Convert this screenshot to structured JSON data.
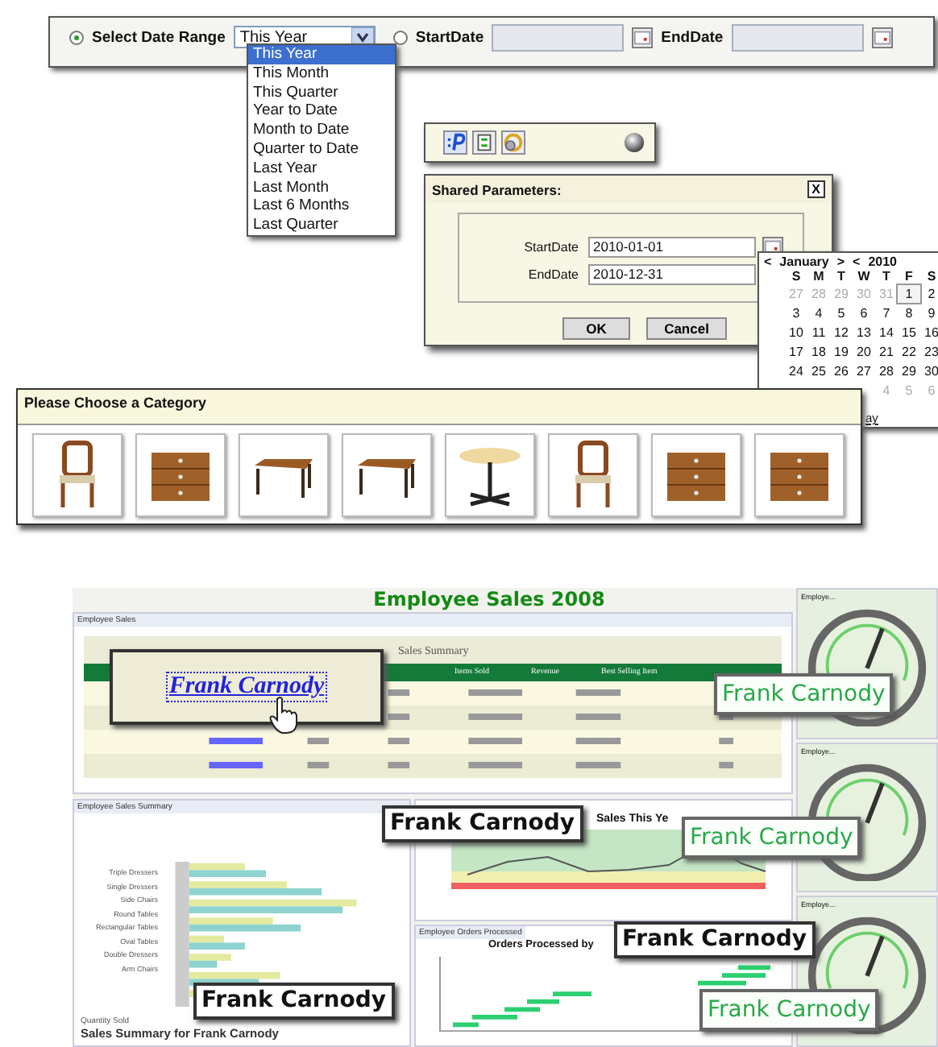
{
  "date_range_bar": {
    "range_option": {
      "label": "Select Date Range",
      "selected": true
    },
    "range_select": {
      "value": "This Year"
    },
    "date_option": {
      "selected": false
    },
    "start_label": "StartDate",
    "end_label": "EndDate"
  },
  "range_dropdown": {
    "items": [
      {
        "label": "This Year",
        "selected": true
      },
      {
        "label": "This Month",
        "selected": false
      },
      {
        "label": "This Quarter",
        "selected": false
      },
      {
        "label": "Year to Date",
        "selected": false
      },
      {
        "label": "Month to Date",
        "selected": false
      },
      {
        "label": "Quarter to Date",
        "selected": false
      },
      {
        "label": "Last Year",
        "selected": false
      },
      {
        "label": "Last Month",
        "selected": false
      },
      {
        "label": "Last 6 Months",
        "selected": false
      },
      {
        "label": "Last Quarter",
        "selected": false
      }
    ]
  },
  "shared_parameters": {
    "title": "Shared Parameters:",
    "close": "X",
    "fields": [
      {
        "label": "StartDate",
        "value": "2010-01-01",
        "calendar": true
      },
      {
        "label": "EndDate",
        "value": "2010-12-31"
      }
    ],
    "buttons": [
      "OK",
      "Cancel"
    ]
  },
  "calendar": {
    "prev_month": "<",
    "month": "January",
    "next_month": ">",
    "prev_year": "<",
    "year": "2010",
    "weekdays": [
      "S",
      "M",
      "T",
      "W",
      "T",
      "F",
      "S"
    ],
    "weeks": [
      [
        {
          "day": "27",
          "other_month": true,
          "selected": false
        },
        {
          "day": "28",
          "other_month": true,
          "selected": false
        },
        {
          "day": "29",
          "other_month": true,
          "selected": false
        },
        {
          "day": "30",
          "other_month": true,
          "selected": false
        },
        {
          "day": "31",
          "other_month": true,
          "selected": false
        },
        {
          "day": "1",
          "other_month": false,
          "selected": true
        },
        {
          "day": "2",
          "other_month": false,
          "selected": false
        }
      ],
      [
        {
          "day": "3",
          "other_month": false,
          "selected": false
        },
        {
          "day": "4",
          "other_month": false,
          "selected": false
        },
        {
          "day": "5",
          "other_month": false,
          "selected": false
        },
        {
          "day": "6",
          "other_month": false,
          "selected": false
        },
        {
          "day": "7",
          "other_month": false,
          "selected": false
        },
        {
          "day": "8",
          "other_month": false,
          "selected": false
        },
        {
          "day": "9",
          "other_month": false,
          "selected": false
        }
      ],
      [
        {
          "day": "10",
          "other_month": false,
          "selected": false
        },
        {
          "day": "11",
          "other_month": false,
          "selected": false
        },
        {
          "day": "12",
          "other_month": false,
          "selected": false
        },
        {
          "day": "13",
          "other_month": false,
          "selected": false
        },
        {
          "day": "14",
          "other_month": false,
          "selected": false
        },
        {
          "day": "15",
          "other_month": false,
          "selected": false
        },
        {
          "day": "16",
          "other_month": false,
          "selected": false
        }
      ],
      [
        {
          "day": "17",
          "other_month": false,
          "selected": false
        },
        {
          "day": "18",
          "other_month": false,
          "selected": false
        },
        {
          "day": "19",
          "other_month": false,
          "selected": false
        },
        {
          "day": "20",
          "other_month": false,
          "selected": false
        },
        {
          "day": "21",
          "other_month": false,
          "selected": false
        },
        {
          "day": "22",
          "other_month": false,
          "selected": false
        },
        {
          "day": "23",
          "other_month": false,
          "selected": false
        }
      ],
      [
        {
          "day": "24",
          "other_month": false,
          "selected": false
        },
        {
          "day": "25",
          "other_month": false,
          "selected": false
        },
        {
          "day": "26",
          "other_month": false,
          "selected": false
        },
        {
          "day": "27",
          "other_month": false,
          "selected": false
        },
        {
          "day": "28",
          "other_month": false,
          "selected": false
        },
        {
          "day": "29",
          "other_month": false,
          "selected": false
        },
        {
          "day": "30",
          "other_month": false,
          "selected": false
        }
      ],
      [
        {
          "day": "4",
          "other_month": true,
          "selected": false
        },
        {
          "day": "5",
          "other_month": true,
          "selected": false
        },
        {
          "day": "6",
          "other_month": true,
          "selected": false
        }
      ]
    ],
    "today_link": "ay"
  },
  "category_panel": {
    "title": "Please Choose a Category",
    "items": [
      {
        "kind": "chair"
      },
      {
        "kind": "dresser"
      },
      {
        "kind": "table"
      },
      {
        "kind": "table"
      },
      {
        "kind": "round-table"
      },
      {
        "kind": "chair"
      },
      {
        "kind": "dresser"
      },
      {
        "kind": "dresser"
      }
    ]
  },
  "dashboard": {
    "title": "Employee Sales 2008",
    "sales_panel": {
      "title": "Employee Sales",
      "table_title": "Sales Summary",
      "columns": [
        "Items Sold",
        "Revenue",
        "Best Selling Item"
      ]
    },
    "summary_panel": {
      "title": "Employee Sales Summary",
      "categories": [
        "Triple Dressers",
        "Single Dressers",
        "Side Chairs",
        "Round Tables",
        "Rectangular Tables",
        "Oval Tables",
        "Double Dressers",
        "Arm Chairs"
      ],
      "axis_label": "Quantity Sold",
      "footer": "Sales Summary for Frank Carnody"
    },
    "line_panel": {
      "title": "Sales This Ye"
    },
    "orders_panel": {
      "title": "Employee Orders Processed",
      "chart_title": "Orders Processed by"
    },
    "gauges": [
      {
        "title": "Employe..."
      },
      {
        "title": "Employe..."
      },
      {
        "title": "Employe..."
      }
    ]
  },
  "callouts": [
    {
      "kind": "link",
      "text": "Frank Carnody"
    },
    {
      "kind": "green",
      "text": "Frank Carnody"
    },
    {
      "kind": "dark",
      "text": "Frank Carnody"
    },
    {
      "kind": "green",
      "text": "Frank Carnody"
    },
    {
      "kind": "dark",
      "text": "Frank Carnody"
    },
    {
      "kind": "dark",
      "text": "Frank Carnody"
    },
    {
      "kind": "green",
      "text": "Frank Carnody"
    }
  ]
}
